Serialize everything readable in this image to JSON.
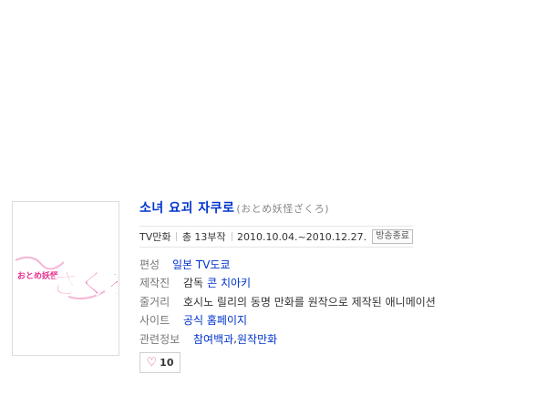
{
  "poster": {
    "logo_text": "ざくろ",
    "logo_small_text": "おとめ妖怪",
    "brand_color": "#e6338f"
  },
  "title": {
    "korean": "소녀 요괴 자쿠로",
    "original": "(おとめ妖怪ざくろ)"
  },
  "meta": {
    "genre": "TV만화",
    "episodes": "총 13부작",
    "period": "2010.10.04.~2010.12.27.",
    "status_badge": "방송종료"
  },
  "details": {
    "channel_label": "편성",
    "channel_value": "일본 TV도쿄",
    "staff_label": "제작진",
    "staff_role": "감독",
    "staff_name": "콘 치아키",
    "synopsis_label": "줄거리",
    "synopsis_value": "호시노 릴리의 동명 만화를 원작으로 제작된 애니메이션",
    "site_label": "사이트",
    "site_value": "공식 홈페이지",
    "related_label": "관련정보",
    "related_link1": "참여백과",
    "related_sep": ", ",
    "related_link2": "원작만화"
  },
  "like": {
    "icon": "heart-icon",
    "count": "10"
  }
}
